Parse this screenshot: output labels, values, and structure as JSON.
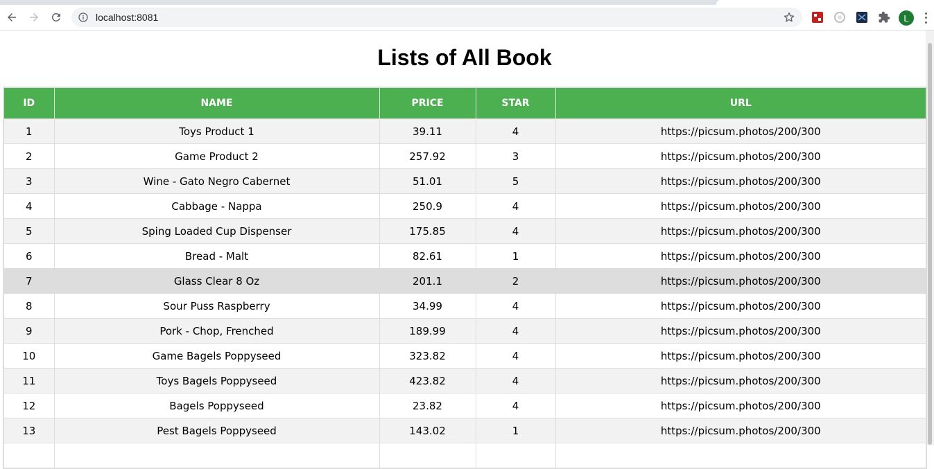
{
  "browser": {
    "url": "localhost:8081",
    "avatar_letter": "L"
  },
  "page": {
    "title": "Lists of All Book"
  },
  "table": {
    "headers": [
      "ID",
      "NAME",
      "PRICE",
      "STAR",
      "URL"
    ],
    "rows": [
      {
        "id": "1",
        "name": "Toys Product 1",
        "price": "39.11",
        "star": "4",
        "url": "https://picsum.photos/200/300"
      },
      {
        "id": "2",
        "name": "Game Product 2",
        "price": "257.92",
        "star": "3",
        "url": "https://picsum.photos/200/300"
      },
      {
        "id": "3",
        "name": "Wine - Gato Negro Cabernet",
        "price": "51.01",
        "star": "5",
        "url": "https://picsum.photos/200/300"
      },
      {
        "id": "4",
        "name": "Cabbage - Nappa",
        "price": "250.9",
        "star": "4",
        "url": "https://picsum.photos/200/300"
      },
      {
        "id": "5",
        "name": "Sping Loaded Cup Dispenser",
        "price": "175.85",
        "star": "4",
        "url": "https://picsum.photos/200/300"
      },
      {
        "id": "6",
        "name": "Bread - Malt",
        "price": "82.61",
        "star": "1",
        "url": "https://picsum.photos/200/300"
      },
      {
        "id": "7",
        "name": "Glass Clear 8 Oz",
        "price": "201.1",
        "star": "2",
        "url": "https://picsum.photos/200/300"
      },
      {
        "id": "8",
        "name": "Sour Puss Raspberry",
        "price": "34.99",
        "star": "4",
        "url": "https://picsum.photos/200/300"
      },
      {
        "id": "9",
        "name": "Pork - Chop, Frenched",
        "price": "189.99",
        "star": "4",
        "url": "https://picsum.photos/200/300"
      },
      {
        "id": "10",
        "name": "Game Bagels Poppyseed",
        "price": "323.82",
        "star": "4",
        "url": "https://picsum.photos/200/300"
      },
      {
        "id": "11",
        "name": "Toys Bagels Poppyseed",
        "price": "423.82",
        "star": "4",
        "url": "https://picsum.photos/200/300"
      },
      {
        "id": "12",
        "name": "Bagels Poppyseed",
        "price": "23.82",
        "star": "4",
        "url": "https://picsum.photos/200/300"
      },
      {
        "id": "13",
        "name": "Pest Bagels Poppyseed",
        "price": "143.02",
        "star": "1",
        "url": "https://picsum.photos/200/300"
      },
      {
        "id": "",
        "name": "",
        "price": "",
        "star": "",
        "url": ""
      }
    ]
  },
  "colors": {
    "header_green": "#4caf50",
    "row_stripe": "#f2f2f2",
    "row_hover": "#dddddd"
  },
  "icons": {
    "back": "back-arrow-icon",
    "forward": "forward-arrow-icon",
    "reload": "reload-icon",
    "site_info": "info-icon",
    "bookmark": "star-icon",
    "extensions": [
      "red-extension-icon",
      "circle-extension-icon",
      "dark-extension-icon",
      "puzzle-icon"
    ],
    "menu": "kebab-menu-icon"
  }
}
